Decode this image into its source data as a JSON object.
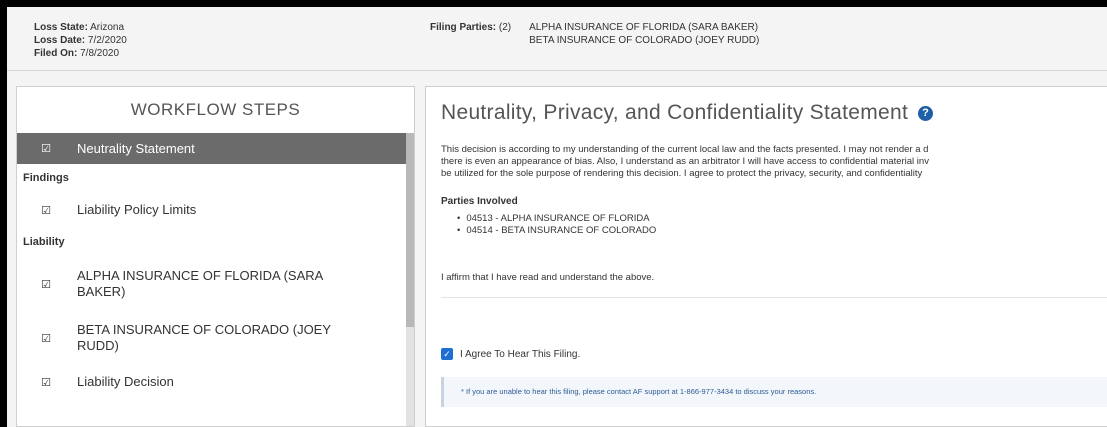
{
  "info": {
    "loss_state_label": "Loss State:",
    "loss_state": "Arizona",
    "loss_date_label": "Loss Date:",
    "loss_date": "7/2/2020",
    "filed_on_label": "Filed On:",
    "filed_on": "7/8/2020",
    "filing_parties_label": "Filing Parties:",
    "filing_parties_count": "(2)",
    "filing_parties": [
      "ALPHA INSURANCE OF FLORIDA  (SARA BAKER)",
      "BETA INSURANCE OF COLORADO  (JOEY RUDD)"
    ]
  },
  "sidebar": {
    "title": "WORKFLOW STEPS",
    "active_item": "Neutrality Statement",
    "section_findings": "Findings",
    "item_policy_limits": "Liability Policy Limits",
    "section_liability": "Liability",
    "item_alpha": "ALPHA INSURANCE OF FLORIDA (SARA BAKER)",
    "item_beta": "BETA INSURANCE OF COLORADO (JOEY RUDD)",
    "item_decision": "Liability Decision"
  },
  "main": {
    "title": "Neutrality, Privacy, and Confidentiality Statement",
    "help_icon": "question-circle-icon",
    "body_lines": [
      "This decision is according to my understanding of the current local law and the facts presented. I may not render a d",
      "there is even an appearance of bias. Also, I understand as an arbitrator I will have access to confidential material inv",
      "be utilized for the sole purpose of rendering this decision. I agree to protect the privacy, security, and confidentiality"
    ],
    "parties_heading": "Parties Involved",
    "parties": [
      "04513 - ALPHA INSURANCE OF FLORIDA",
      "04514 - BETA INSURANCE OF COLORADO"
    ],
    "affirm": "I affirm that I have read and understand the above.",
    "agree_label": "I Agree To Hear This Filing.",
    "note": "* If you are unable to hear this filing, please contact AF support at 1-866-977-3434 to discuss your reasons."
  },
  "colors": {
    "accent": "#1f5fa8",
    "active_step_bg": "#6b6b6b",
    "checkbox": "#1f6fd1"
  }
}
